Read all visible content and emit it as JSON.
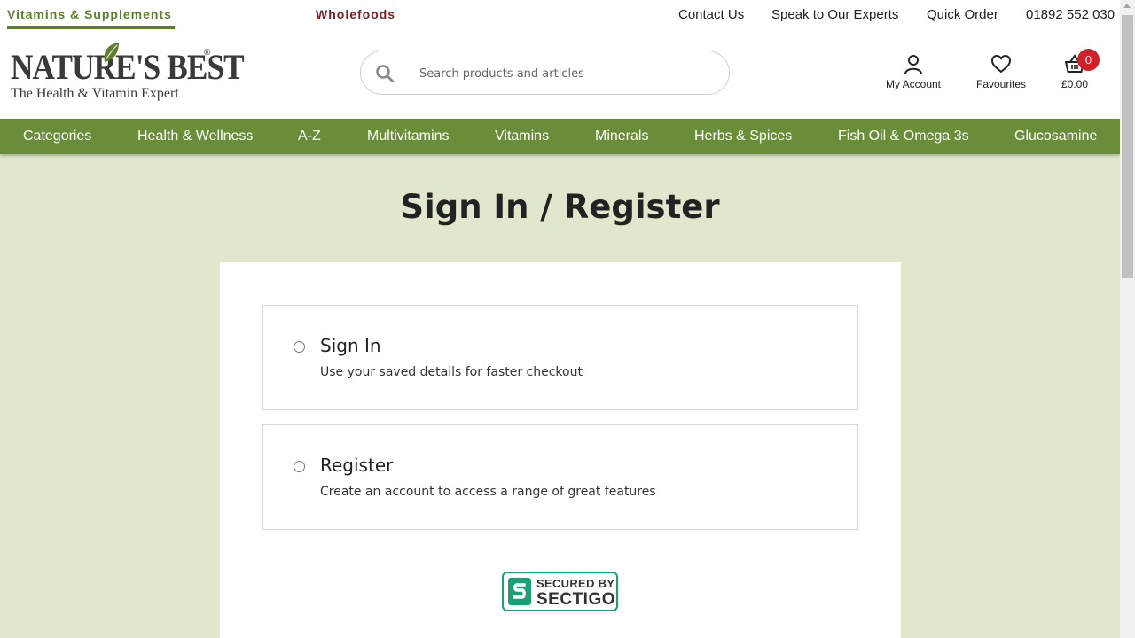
{
  "top_tabs": {
    "vitamins": "Vitamins & Supplements",
    "wholefoods": "Wholefoods"
  },
  "utility_links": {
    "contact": "Contact Us",
    "experts": "Speak to Our Experts",
    "quick_order": "Quick Order",
    "phone": "01892 552 030"
  },
  "logo": {
    "name": "NATURE'S BEST",
    "reg": "®",
    "tagline": "The Health & Vitamin Expert"
  },
  "search": {
    "placeholder": "Search products and articles",
    "value": ""
  },
  "header": {
    "account_label": "My Account",
    "favourites_label": "Favourites",
    "cart_total": "£0.00",
    "cart_count": "0"
  },
  "nav": {
    "items": [
      {
        "label": "Categories"
      },
      {
        "label": "Health & Wellness"
      },
      {
        "label": "A-Z"
      },
      {
        "label": "Multivitamins"
      },
      {
        "label": "Vitamins"
      },
      {
        "label": "Minerals"
      },
      {
        "label": "Herbs & Spices"
      },
      {
        "label": "Fish Oil & Omega 3s"
      },
      {
        "label": "Glucosamine"
      }
    ]
  },
  "page": {
    "title": "Sign In / Register"
  },
  "options": [
    {
      "title": "Sign In",
      "description": "Use your saved details for faster checkout",
      "selected": false
    },
    {
      "title": "Register",
      "description": "Create an account to access a range of great features",
      "selected": false
    }
  ],
  "badge": {
    "line1": "SECURED BY",
    "line2": "SECTIGO"
  },
  "colors": {
    "brand_green": "#6a8d3a",
    "tab_green": "#5d7f2d",
    "wholefoods_red": "#7a1f1f",
    "page_bg": "#dfe8cc",
    "badge_red": "#d0202a",
    "sectigo_green": "#1aa074"
  },
  "icons": [
    "search-icon",
    "account-icon",
    "heart-icon",
    "basket-icon",
    "leaf-icon",
    "sectigo-logo-icon"
  ]
}
